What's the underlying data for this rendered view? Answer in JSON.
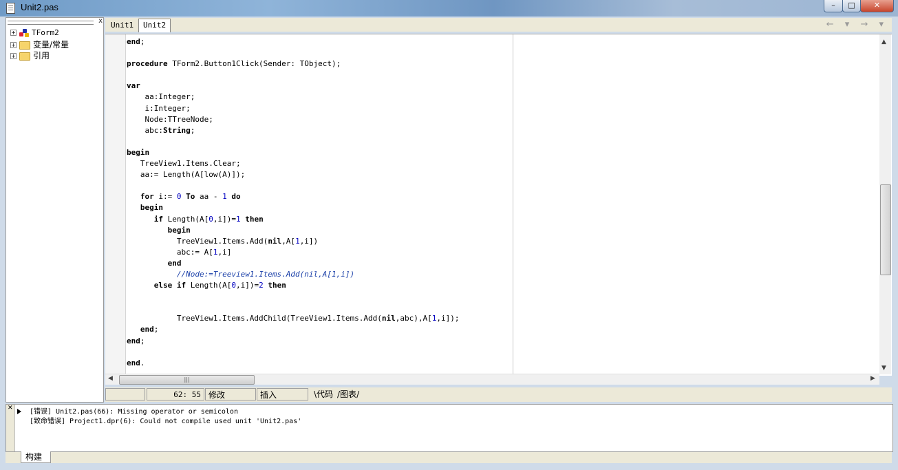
{
  "window": {
    "title": "Unit2.pas",
    "buttons": {
      "minimize": "–",
      "maximize": "□",
      "close": "✕"
    }
  },
  "structure_panel": {
    "close_glyph": "x",
    "items": [
      {
        "label": "TForm2",
        "icon": "form-icon"
      },
      {
        "label": "变量/常量",
        "icon": "folder-icon"
      },
      {
        "label": "引用",
        "icon": "folder-icon"
      }
    ]
  },
  "editor": {
    "tabs": [
      {
        "label": "Unit1",
        "active": false
      },
      {
        "label": "Unit2",
        "active": true
      }
    ],
    "nav": "← ▾ → ▾"
  },
  "status": {
    "position": "62:  55",
    "modified": "修改",
    "insert_mode": "插入",
    "view_tabs": [
      "代码",
      "图表"
    ]
  },
  "messages": {
    "lines": [
      "[错误] Unit2.pas(66): Missing operator or semicolon",
      "[致命错误] Project1.dpr(6): Could not compile used unit 'Unit2.pas'"
    ],
    "tab": "构建"
  },
  "colors": {
    "keyword": "#000000",
    "number": "#0000c0",
    "comment": "#1a3fa8"
  }
}
